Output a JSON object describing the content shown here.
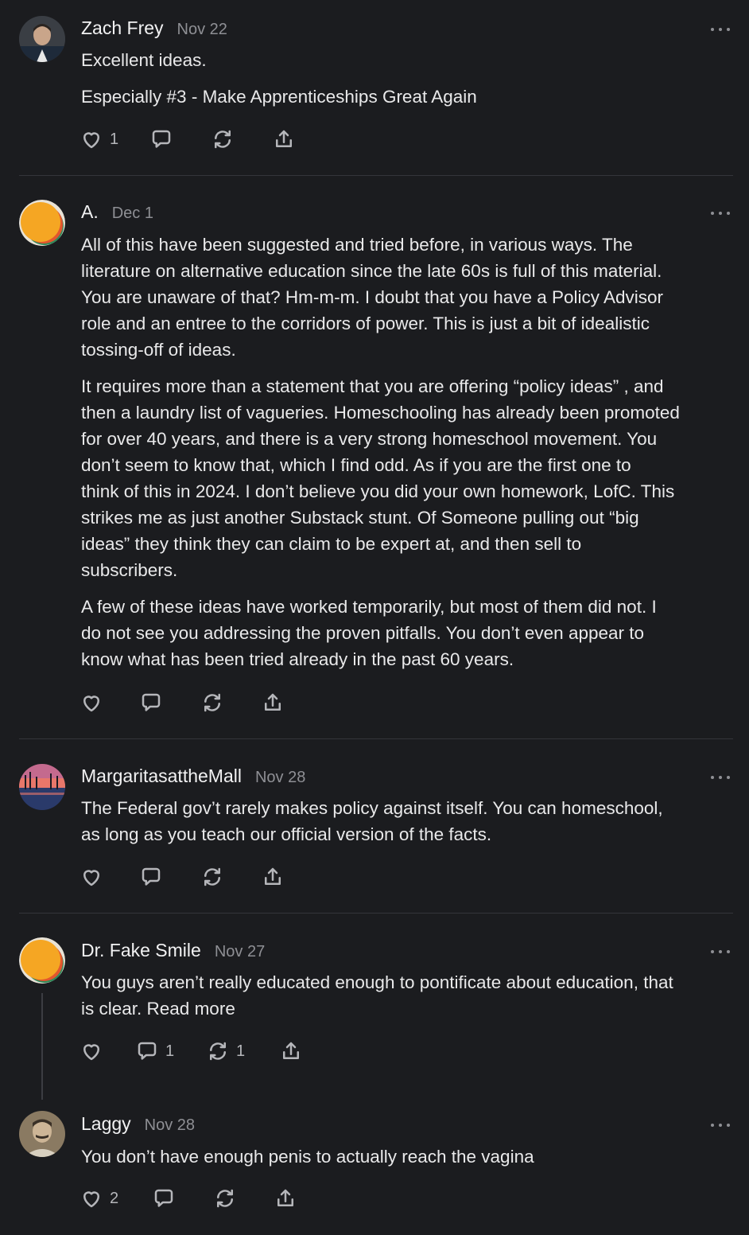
{
  "comments": [
    {
      "author": "Zach Frey",
      "date": "Nov 22",
      "paragraphs": [
        "Excellent ideas.",
        "Especially #3 - Make Apprenticeships Great Again"
      ],
      "likes": "1",
      "replies": "",
      "restacks": ""
    },
    {
      "author": "A.",
      "date": "Dec 1",
      "paragraphs": [
        "All of this have been suggested and tried before, in various ways. The\nliterature on alternative education since the late 60s is full of this material.\nYou are unaware of that? Hm-m-m. I doubt that you have a Policy Advisor\nrole and an entree to the corridors of power. This is just a bit of idealistic\ntossing-off of ideas.",
        "It requires more than a statement that you are offering “policy ideas” , and\nthen a laundry list of vagueries. Homeschooling has already been promoted\nfor over 40 years, and there is a very strong homeschool movement. You\ndon’t seem to know that, which I find odd. As if you are the first one to\nthink of this in 2024. I don’t believe you did your own homework, LofC. This\nstrikes me as just another Substack stunt. Of Someone pulling out “big\nideas” they think they can claim to be expert at, and then sell to\nsubscribers.",
        "A few of these ideas have worked temporarily, but most of them did not. I\ndo not see you addressing the proven pitfalls. You don’t even appear to\nknow what has been tried already in the past 60 years."
      ],
      "likes": "",
      "replies": "",
      "restacks": ""
    },
    {
      "author": "MargaritasattheMall",
      "date": "Nov 28",
      "paragraphs": [
        "The Federal gov’t rarely makes policy against itself. You can homeschool,\nas long as you teach our official version of the facts."
      ],
      "likes": "",
      "replies": "",
      "restacks": ""
    },
    {
      "author": "Dr. Fake Smile",
      "date": "Nov 27",
      "paragraphs": [
        "You guys aren’t really educated enough to pontificate about education, that\nis clear. Read more"
      ],
      "likes": "",
      "replies": "1",
      "restacks": "1"
    },
    {
      "author": "Laggy",
      "date": "Nov 28",
      "paragraphs": [
        "You don’t have enough penis to actually reach the vagina"
      ],
      "likes": "2",
      "replies": "",
      "restacks": ""
    }
  ],
  "icons": {
    "like": "heart-icon",
    "reply": "comment-bubble-icon",
    "restack": "restack-icon",
    "share": "share-icon",
    "more": "more-options-icon"
  },
  "colors": {
    "background": "#1b1c1f",
    "text": "#e9e9ea",
    "muted": "#8e8f94",
    "divider": "#34353a"
  }
}
